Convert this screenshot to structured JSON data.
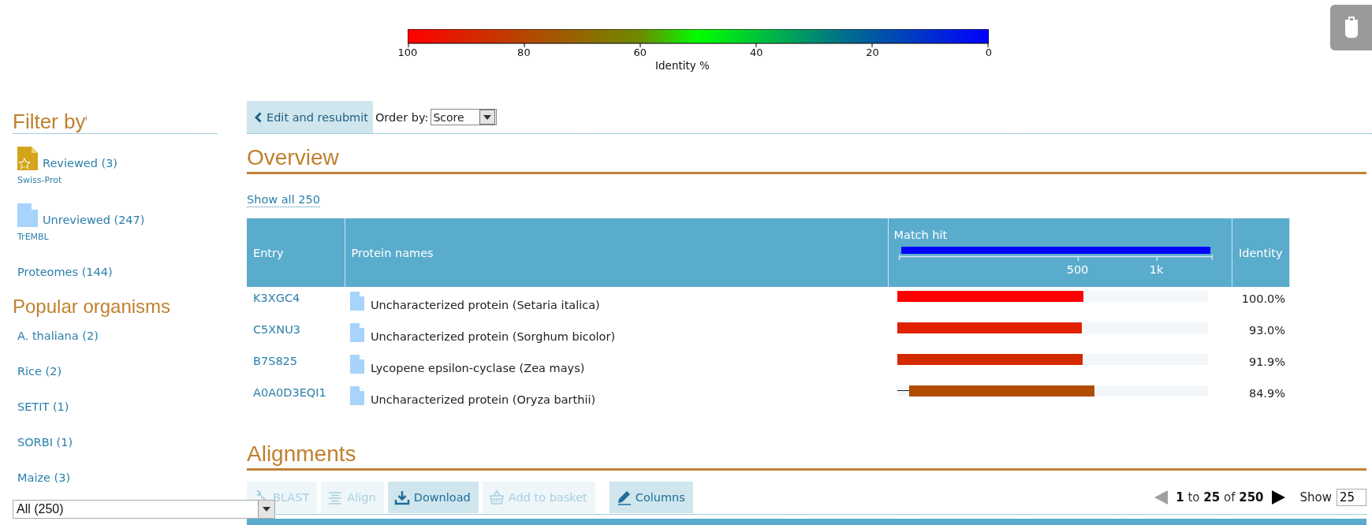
{
  "legend": {
    "ticks": [
      "100",
      "80",
      "60",
      "40",
      "20",
      "0"
    ],
    "label": "Identity %"
  },
  "sidebar": {
    "title": "Filter by$^{i}$",
    "status_filters": [
      {
        "kind": "reviewed",
        "label": "Reviewed (3)",
        "sub": "Swiss-Prot"
      },
      {
        "kind": "unreviewed",
        "label": "Unreviewed (247)",
        "sub": "TrEMBL"
      }
    ],
    "proteomes": "Proteomes (144)",
    "organisms_title": "Popular organisms",
    "organisms": [
      "A. thaliana (2)",
      "Rice (2)",
      "SETIT (1)",
      "SORBI (1)",
      "Maize (3)"
    ],
    "organism_select": {
      "value": "All (250)"
    }
  },
  "toolbar": {
    "edit_button": "Edit and resubmit",
    "order_label": "Order by:",
    "order_select": {
      "value": "Score"
    }
  },
  "overview": {
    "title": "Overview",
    "show_all": "Show all 250",
    "table": {
      "columns": [
        "Entry",
        "Protein names",
        "Match hit",
        "Identity"
      ],
      "axis_labels": [
        "500",
        "1k"
      ],
      "rows": [
        {
          "entry": "K3XGC4",
          "protein": "Uncharacterized protein (Setaria italica)",
          "hit": {
            "kind": "full",
            "level": 0.6,
            "color": "#ff0000"
          },
          "identity": "100.0%"
        },
        {
          "entry": "C5XNU3",
          "protein": "Uncharacterized protein (Sorghum bicolor)",
          "hit": {
            "kind": "full",
            "level": 0.594,
            "color": "#e02000"
          },
          "identity": "93.0%"
        },
        {
          "entry": "B7S825",
          "protein": "Lycopene epsilon-cyclase (Zea mays)",
          "hit": {
            "kind": "full",
            "level": 0.597,
            "color": "#d42a00"
          },
          "identity": "91.9%"
        },
        {
          "entry": "A0A0D3EQI1",
          "protein": "Uncharacterized protein (Oryza barthii)",
          "hit": {
            "kind": "gapped",
            "level": 0.635,
            "color": "#b04c00"
          },
          "identity": "84.9%"
        }
      ]
    }
  },
  "alignments": {
    "title": "Alignments",
    "actions": [
      {
        "kind": "wrench",
        "label": "BLAST",
        "disabled": true
      },
      {
        "kind": "lines",
        "label": "Align",
        "disabled": true
      },
      {
        "kind": "download",
        "label": "Download",
        "disabled": false
      },
      {
        "kind": "basket",
        "label": "Add to basket",
        "disabled": true
      },
      {
        "kind": "pencil",
        "label": "Columns",
        "disabled": false
      }
    ],
    "pager": {
      "range": "**1** to **25** of **250**",
      "prev_disabled": true,
      "next_disabled": false,
      "show_label": "Show",
      "page_size": "25"
    }
  }
}
